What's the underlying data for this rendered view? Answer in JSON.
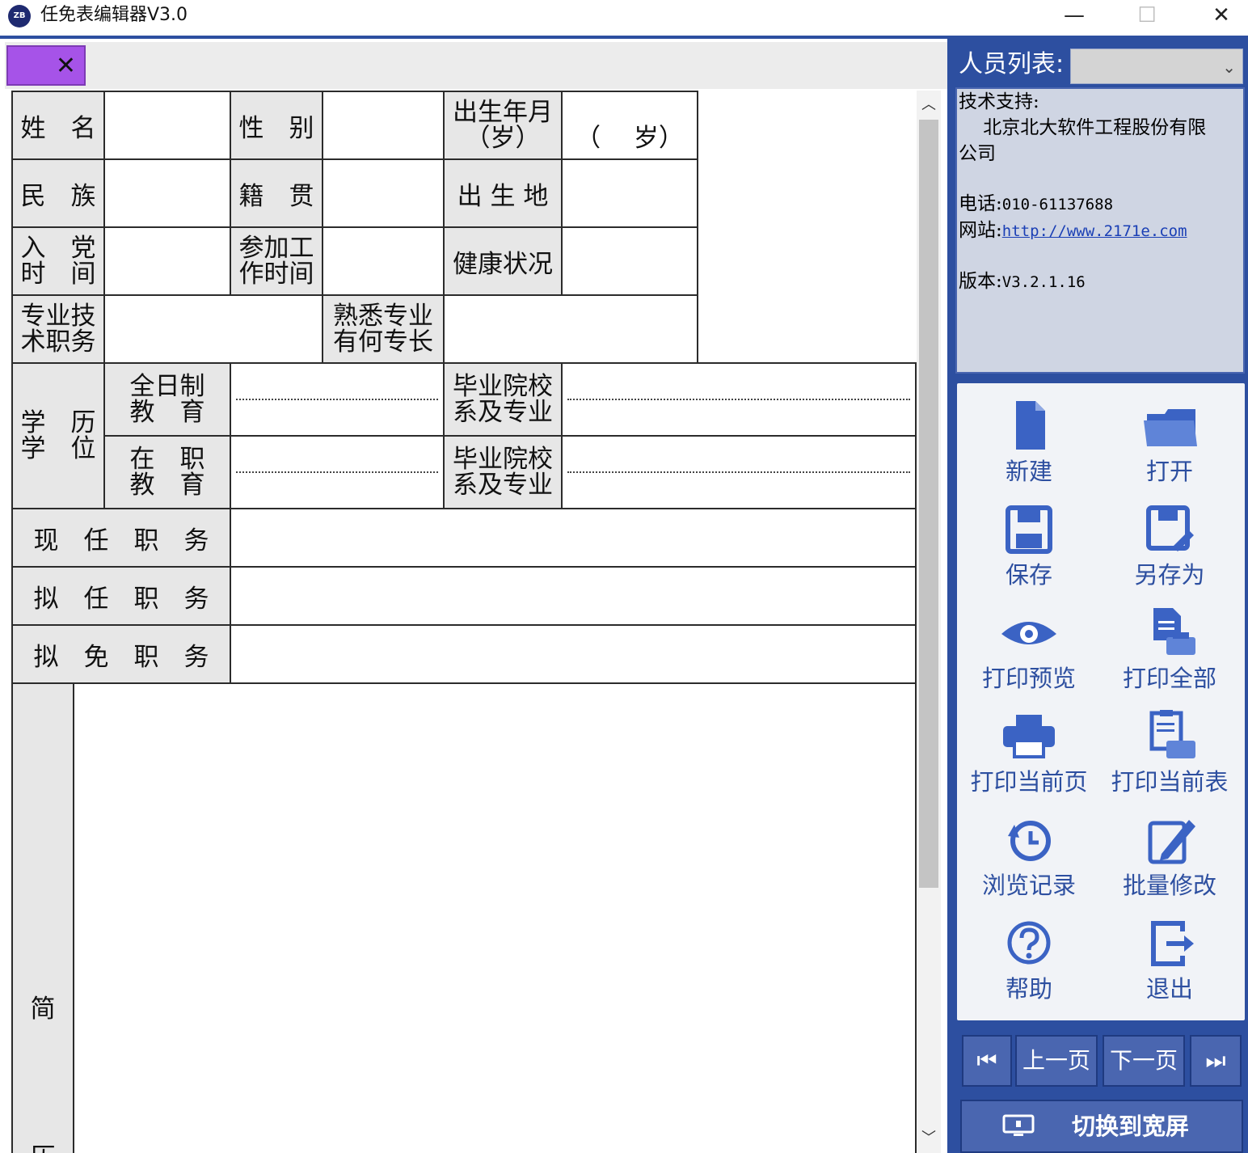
{
  "window": {
    "title": "任免表编辑器V3.0",
    "logo_text": "ZB",
    "minimize": "—",
    "maximize": "☐",
    "close": "✕"
  },
  "colors": {
    "accent": "#2d4fa0",
    "tab": "#a653e8",
    "label_bg": "#e7e7e7",
    "panel_bg": "#cfd5e3"
  },
  "tab": {
    "close": "✕"
  },
  "form": {
    "name_label": "姓　名",
    "gender_label": "性　别",
    "birth_label_1": "出生年月",
    "birth_label_2": "（岁）",
    "age_value": "（　 岁）",
    "ethnicity_label": "民　族",
    "native_label": "籍　贯",
    "birthplace_label": "出 生 地",
    "party_label_1": "入　党",
    "party_label_2": "时　间",
    "work_label_1": "参加工",
    "work_label_2": "作时间",
    "health_label": "健康状况",
    "tech_label_1": "专业技",
    "tech_label_2": "术职务",
    "skill_label_1": "熟悉专业",
    "skill_label_2": "有何专长",
    "edu_label_1": "学　历",
    "edu_label_2": "学　位",
    "fulltime_label_1": "全日制",
    "fulltime_label_2": "教　育",
    "school_label_1": "毕业院校",
    "school_label_2": "系及专业",
    "inservice_label_1": "在　职",
    "inservice_label_2": "教　育",
    "current_post_label": "现　任　职　务",
    "proposed_post_label": "拟　任　职　务",
    "proposed_removal_label": "拟　免　职　务",
    "resume_label": "简",
    "resume_label_2": "历"
  },
  "scrollbar": {
    "up": "︿",
    "down": "﹀"
  },
  "sidebar": {
    "people_label": "人员列表:",
    "people_chevron": "⌄",
    "support_label": "技术支持:",
    "company_1": "　 北京北大软件工程股份有限",
    "company_2": "公司",
    "phone_label": "电话:",
    "phone": "010-61137688",
    "site_label": "网站:",
    "site": "http://www.2171e.com",
    "version_label": "版本:",
    "version": "V3.2.1.16"
  },
  "commands": [
    {
      "label": "新建",
      "icon": "new-file-icon"
    },
    {
      "label": "打开",
      "icon": "open-folder-icon"
    },
    {
      "label": "保存",
      "icon": "save-icon"
    },
    {
      "label": "另存为",
      "icon": "save-as-icon"
    },
    {
      "label": "打印预览",
      "icon": "eye-icon"
    },
    {
      "label": "打印全部",
      "icon": "print-all-icon"
    },
    {
      "label": "打印当前页",
      "icon": "printer-icon"
    },
    {
      "label": "打印当前表",
      "icon": "print-table-icon"
    },
    {
      "label": "浏览记录",
      "icon": "history-icon"
    },
    {
      "label": "批量修改",
      "icon": "edit-icon"
    },
    {
      "label": "帮助",
      "icon": "help-icon"
    },
    {
      "label": "退出",
      "icon": "exit-icon"
    }
  ],
  "nav": {
    "first": "⏮",
    "prev": "上一页",
    "next": "下一页",
    "last": "⏭",
    "wide": "切换到宽屏"
  }
}
